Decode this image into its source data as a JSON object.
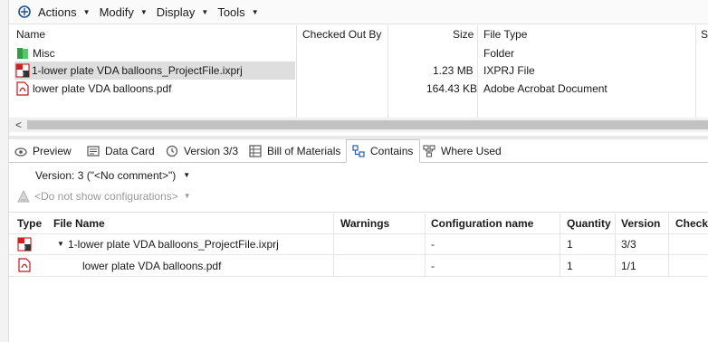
{
  "toolbar": {
    "menus": [
      {
        "label": "Actions"
      },
      {
        "label": "Modify"
      },
      {
        "label": "Display"
      },
      {
        "label": "Tools"
      }
    ]
  },
  "file_list": {
    "columns": [
      "Name",
      "Checked Out By",
      "Size",
      "File Type",
      "S"
    ],
    "rows": [
      {
        "name": "Misc",
        "checked_out_by": "",
        "size": "",
        "type": "Folder",
        "icon": "folder-icon"
      },
      {
        "name": "1-lower plate VDA balloons_ProjectFile.ixprj",
        "checked_out_by": "",
        "size": "1.23 MB",
        "type": "IXPRJ File",
        "icon": "project-file-icon"
      },
      {
        "name": "lower plate VDA balloons.pdf",
        "checked_out_by": "",
        "size": "164.43 KB",
        "type": "Adobe Acrobat Document",
        "icon": "pdf-icon"
      }
    ]
  },
  "scroll_left_glyph": "<",
  "tabs": [
    {
      "label": "Preview",
      "icon": "preview-icon"
    },
    {
      "label": "Data Card",
      "icon": "data-card-icon"
    },
    {
      "label": "Version 3/3",
      "icon": "version-icon"
    },
    {
      "label": "Bill of Materials",
      "icon": "bom-icon"
    },
    {
      "label": "Contains",
      "icon": "contains-icon",
      "active": true
    },
    {
      "label": "Where Used",
      "icon": "where-used-icon"
    }
  ],
  "contains": {
    "version_selector": "Version: 3 (\"<No comment>\")",
    "config_selector": "<Do not show configurations>",
    "columns": [
      "Type",
      "File Name",
      "Warnings",
      "Configuration name",
      "Quantity",
      "Version",
      "Checke"
    ],
    "rows": [
      {
        "file_name": "1-lower plate VDA balloons_ProjectFile.ixprj",
        "warnings": "",
        "configuration": "-",
        "quantity": "1",
        "version": "3/3",
        "icon": "project-file-icon"
      },
      {
        "file_name": "lower plate VDA balloons.pdf",
        "warnings": "",
        "configuration": "-",
        "quantity": "1",
        "version": "1/1",
        "icon": "pdf-icon"
      }
    ]
  }
}
